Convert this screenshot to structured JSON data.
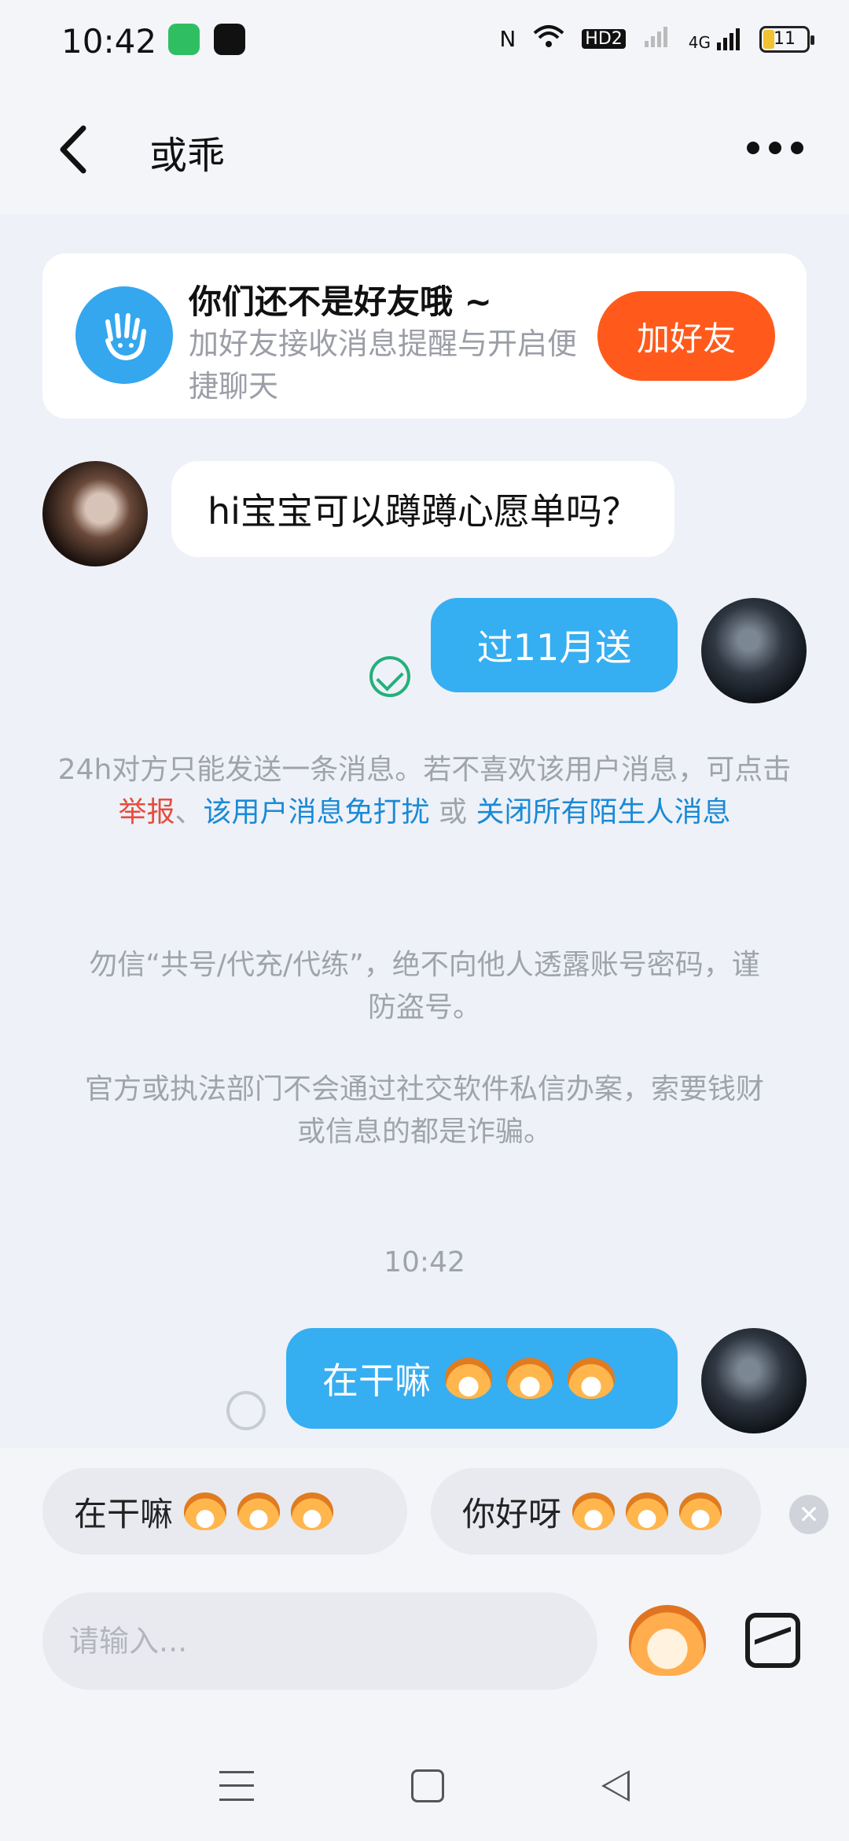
{
  "status_bar": {
    "time": "10:42",
    "network": "HD2",
    "signal": "4G",
    "battery": "11"
  },
  "header": {
    "title": "或乖"
  },
  "friend_banner": {
    "title": "你们还不是好友哦 ~",
    "subtitle": "加好友接收消息提醒与开启便捷聊天",
    "button": "加好友"
  },
  "messages": [
    {
      "side": "incoming",
      "text": "hi宝宝可以蹲蹲心愿单吗？"
    },
    {
      "side": "outgoing",
      "text": "过11月送",
      "status": "read"
    },
    {
      "side": "outgoing",
      "text": "在干嘛",
      "status": "sending"
    }
  ],
  "notices": {
    "limit_prefix": "24h对方只能发送一条消息。若不喜欢该用户消息，可点击",
    "report": "举报",
    "sep": "、",
    "mute_user": "该用户消息免打扰",
    "or": "或",
    "close_strangers": "关闭所有陌生人消息",
    "warning1": "勿信“共号/代充/代练”，绝不向他人透露账号密码，谨防盗号。",
    "warning2": "官方或执法部门不会通过社交软件私信办案，索要钱财或信息的都是诈骗。"
  },
  "timestamp": "10:42",
  "quick_replies": [
    "在干嘛",
    "你好呀"
  ],
  "input": {
    "placeholder": "请输入..."
  },
  "icons": {
    "back": "chevron-left-icon",
    "more": "more-dots-icon",
    "wave": "wave-hand-icon",
    "emoji": "emoji-icon",
    "image": "image-icon"
  }
}
